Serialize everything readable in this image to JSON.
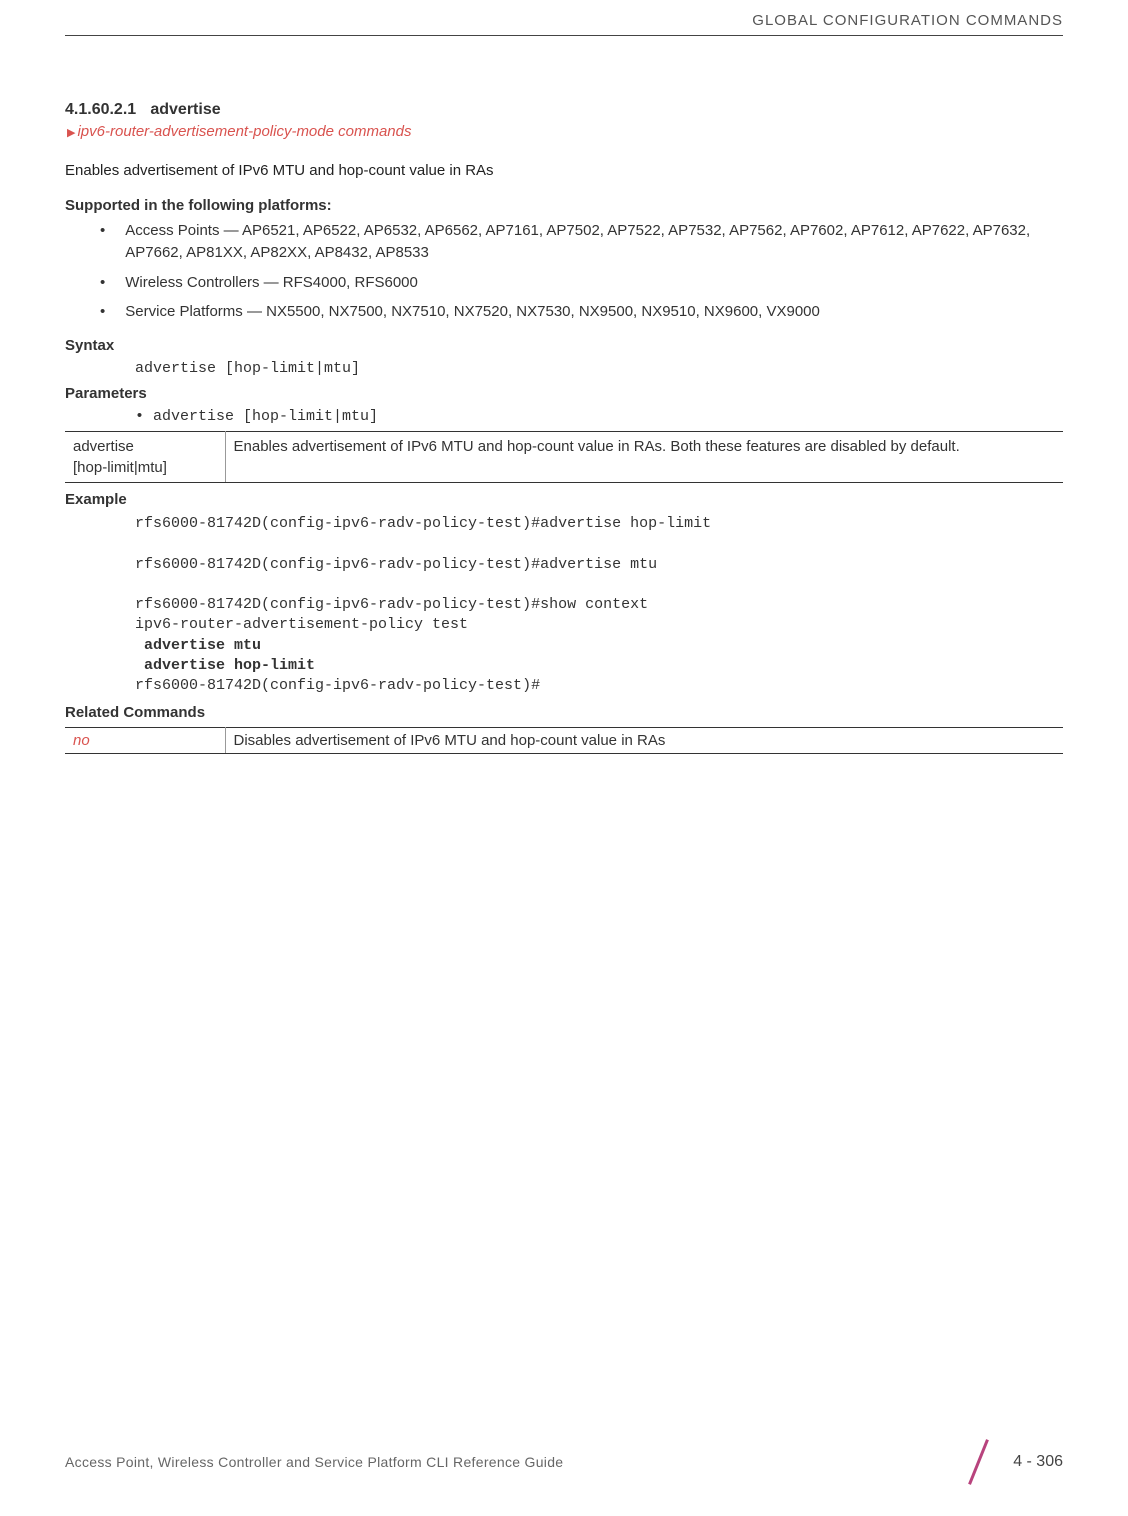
{
  "header": {
    "title": "GLOBAL CONFIGURATION COMMANDS"
  },
  "section": {
    "number": "4.1.60.2.1",
    "title": "advertise",
    "link_text": "ipv6-router-advertisement-policy-mode commands",
    "description": "Enables advertisement of IPv6 MTU and hop-count value in RAs"
  },
  "supported": {
    "label": "Supported in the following platforms:",
    "items": [
      "Access Points — AP6521, AP6522, AP6532, AP6562, AP7161, AP7502, AP7522, AP7532, AP7562, AP7602, AP7612, AP7622, AP7632, AP7662, AP81XX, AP82XX, AP8432, AP8533",
      "Wireless Controllers — RFS4000, RFS6000",
      "Service Platforms — NX5500, NX7500, NX7510, NX7520, NX7530, NX9500, NX9510, NX9600, VX9000"
    ]
  },
  "syntax": {
    "label": "Syntax",
    "code": "advertise [hop-limit|mtu]"
  },
  "parameters": {
    "label": "Parameters",
    "code": "advertise [hop-limit|mtu]",
    "table": {
      "left1": "advertise",
      "left2": "[hop-limit|mtu]",
      "right": "Enables advertisement of IPv6 MTU and hop-count value in RAs. Both these features are disabled by default."
    }
  },
  "example": {
    "label": "Example",
    "line1": "rfs6000-81742D(config-ipv6-radv-policy-test)#advertise hop-limit",
    "line2": "rfs6000-81742D(config-ipv6-radv-policy-test)#advertise mtu",
    "line3": "rfs6000-81742D(config-ipv6-radv-policy-test)#show context",
    "line4": "ipv6-router-advertisement-policy test",
    "line5": " advertise mtu",
    "line6": " advertise hop-limit",
    "line7": "rfs6000-81742D(config-ipv6-radv-policy-test)#"
  },
  "related": {
    "label": "Related Commands",
    "table": {
      "left": "no",
      "right": "Disables advertisement of IPv6 MTU and hop-count value in RAs"
    }
  },
  "footer": {
    "left": "Access Point, Wireless Controller and Service Platform CLI Reference Guide",
    "page": "4 - 306"
  }
}
